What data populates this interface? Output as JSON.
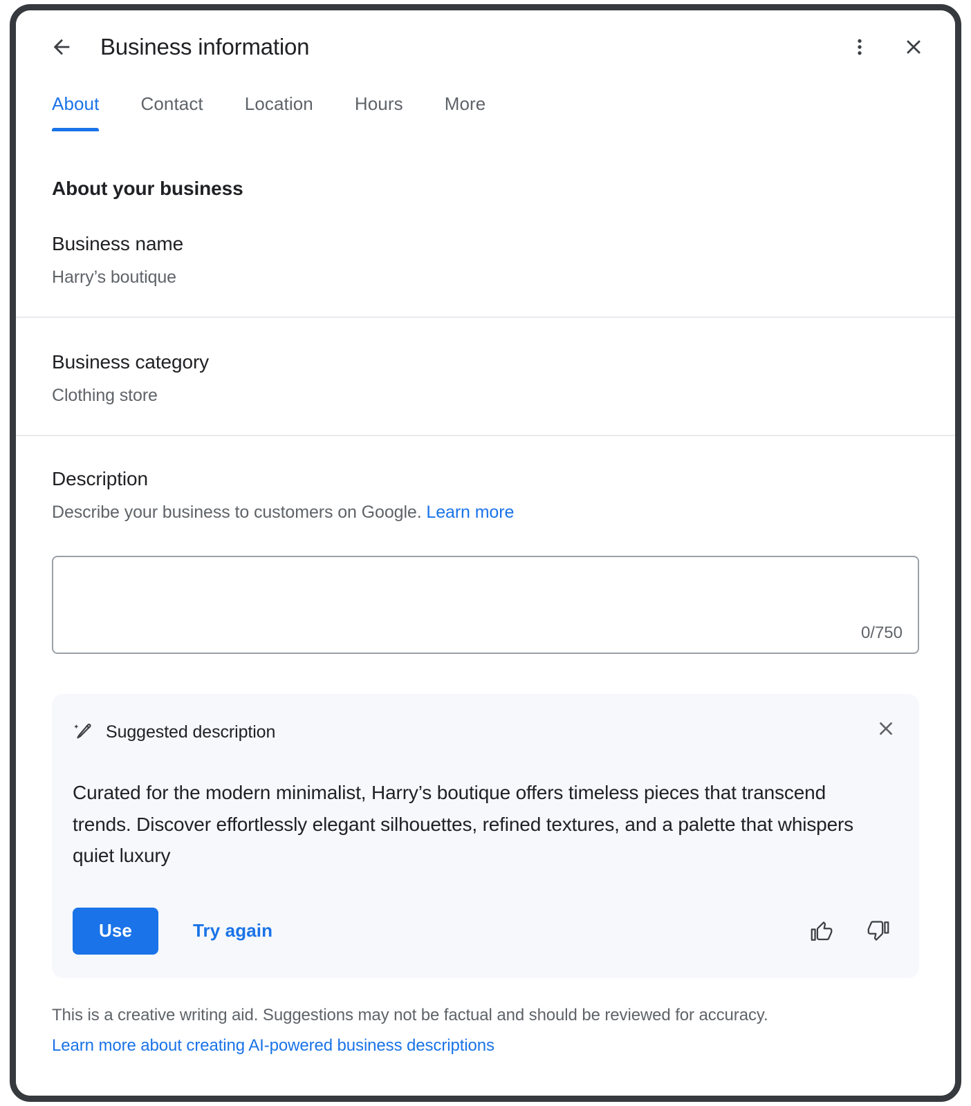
{
  "window": {
    "header": {
      "title": "Business information",
      "back_icon": "arrow-back-icon",
      "overflow_icon": "more-vert-icon",
      "close_icon": "close-icon"
    }
  },
  "tabs": [
    {
      "label": "About",
      "active": true
    },
    {
      "label": "Contact",
      "active": false
    },
    {
      "label": "Location",
      "active": false
    },
    {
      "label": "Hours",
      "active": false
    },
    {
      "label": "More",
      "active": false
    }
  ],
  "main": {
    "section_title": "About your business",
    "fields": [
      {
        "label": "Business name",
        "value": "Harry’s boutique"
      },
      {
        "label": "Business category",
        "value": "Clothing store"
      }
    ],
    "description": {
      "label": "Description",
      "help_text": "Describe your business to customers on Google.",
      "help_link": "Learn more",
      "textarea_value": "",
      "textarea_placeholder": "",
      "char_count": "0/750"
    },
    "suggestion": {
      "icon": "magic-wand-sparkle-icon",
      "title": "Suggested description",
      "close_icon": "close-icon",
      "body": "Curated for the modern minimalist, Harry’s boutique offers timeless pieces that transcend trends.  Discover effortlessly elegant silhouettes, refined textures, and a palette that whispers quiet luxury",
      "use_label": "Use",
      "try_again_label": "Try again",
      "thumb_up_icon": "thumb-up-icon",
      "thumb_down_icon": "thumb-down-icon"
    },
    "footer": {
      "note": "This is a creative writing aid. Suggestions may not be factual and should be reviewed for accuracy.",
      "link": "Learn more about creating AI-powered business descriptions"
    }
  },
  "colors": {
    "accent": "#1a73e8",
    "text_primary": "#202124",
    "text_secondary": "#5f6368",
    "card_bg": "#f6f8fb",
    "frame": "#36393d"
  }
}
